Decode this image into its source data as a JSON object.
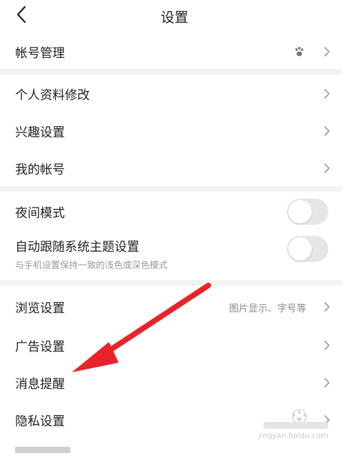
{
  "header": {
    "title": "设置"
  },
  "rows": {
    "account_manage": "帐号管理",
    "profile_edit": "个人资料修改",
    "interest": "兴趣设置",
    "my_account": "我的帐号",
    "night_mode": "夜间模式",
    "auto_theme": "自动跟随系统主题设置",
    "auto_theme_sub": "与手机设置保持一致的浅色或深色模式",
    "browse": "浏览设置",
    "browse_hint": "图片显示、字号等",
    "ads": "广告设置",
    "notify": "消息提醒",
    "privacy": "隐私设置"
  },
  "toggles": {
    "night_mode_on": false,
    "auto_theme_on": false
  },
  "watermark": {
    "site": "jingyan.baidu.com"
  },
  "colors": {
    "arrow": "#e8232b",
    "divider": "#f3f3f3",
    "toggle_off": "#e6e6e6"
  }
}
